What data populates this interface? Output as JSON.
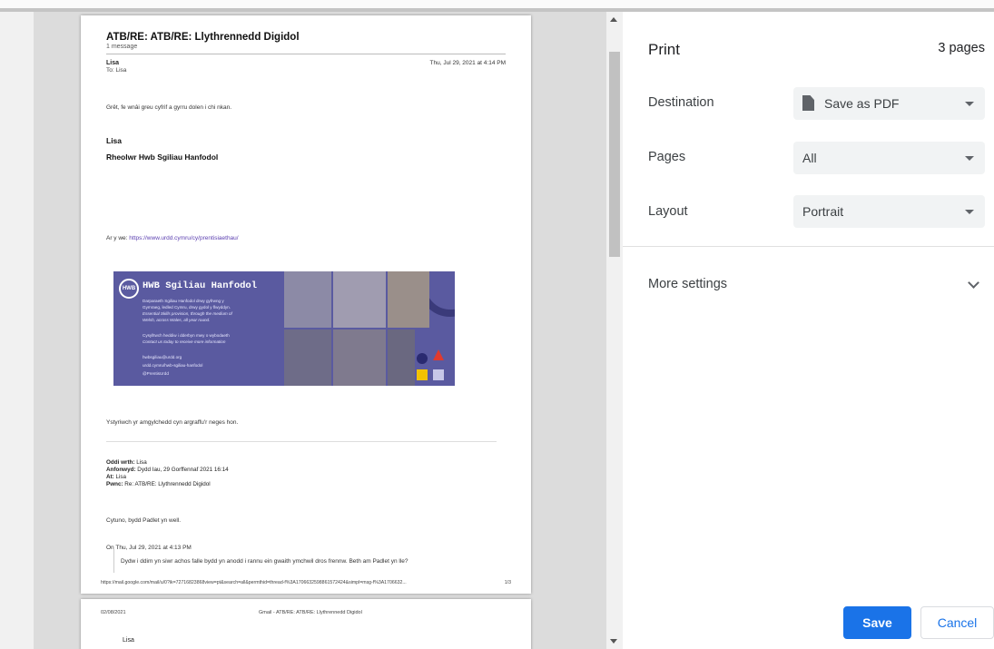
{
  "preview": {
    "page1": {
      "subject": "ATB/RE: ATB/RE: Llythrennedd Digidol",
      "message_count": "1 message",
      "sender": "Lisa",
      "to": "To: Lisa",
      "date": "Thu, Jul 29, 2021 at 4:14 PM",
      "body_line1": "Grêt, fe wnâi greu cyfrif a gyrru dolen i chi nkan.",
      "sig_name": "Lisa",
      "sig_role": "Rheolwr Hwb Sgiliau Hanfodol",
      "web_prefix": "Ar y we: ",
      "web_link": "https://www.urdd.cymru/cy/prentisiaethau/",
      "banner": {
        "logo": "HWB",
        "title": "HWB Sgiliau Hanfodol",
        "line1": "Darparaeth Sgiliau Hanfodol drwy gyfrwng y",
        "line2": "Gymraeg, ledled Cymru, drwy gydol y flwyddyn.",
        "line3": "Essential Skills provision, through the medium of",
        "line4": "Welsh, across Wales, all year round.",
        "line5": "Cysylltwch heddiw i dderbyn mwy o wybodaeth",
        "line6": "Contact us today to receive more information",
        "email": "hwbsgiliau@urdd.org",
        "url": "urdd.cymru/hwb-sgiliau-hanfodol",
        "social": "@PrentisUrdd"
      },
      "env_note": "Ystyriwch yr amgylchedd cyn argraffu'r neges hon.",
      "from_label": "Oddi wrth:",
      "from_value": " Lisa",
      "sent_label": "Anfonwyd:",
      "sent_value": " Dydd Iau, 29 Gorffennaf 2021 16:14",
      "to_label": "At:",
      "to_value": " Lisa",
      "subj_label": "Pwnc:",
      "subj_value": " Re: ATB/RE: Llythrennedd Digidol",
      "reply_line": "Cytuno, bydd Padlet yn well.",
      "on_line": "On Thu, Jul 29, 2021 at 4:13 PM",
      "quote_line": "Dydw i ddim yn siwr achos falle bydd yn anodd i rannu ein gwaith ymchwil dros frennw. Beth am Padlet yn lle?",
      "footer_url": "https://mail.google.com/mail/u/0?ik=72716823868view=pt&search=all&permthid=thread-f%3A1706632598861572424&simpl=msg-f%3A1706632...",
      "page_num": "1/3"
    },
    "page2": {
      "date": "02/08/2021",
      "header_title": "Gmail - ATB/RE: ATB/RE: Llythrennedd Digidol",
      "first_line": "Lisa"
    }
  },
  "settings": {
    "title": "Print",
    "pages_count": "3 pages",
    "destination": {
      "label": "Destination",
      "value": "Save as PDF",
      "icon": "document-icon"
    },
    "pages": {
      "label": "Pages",
      "value": "All"
    },
    "layout": {
      "label": "Layout",
      "value": "Portrait"
    },
    "more_settings": "More settings",
    "save_label": "Save",
    "cancel_label": "Cancel",
    "accent_color": "#1a73e8"
  }
}
